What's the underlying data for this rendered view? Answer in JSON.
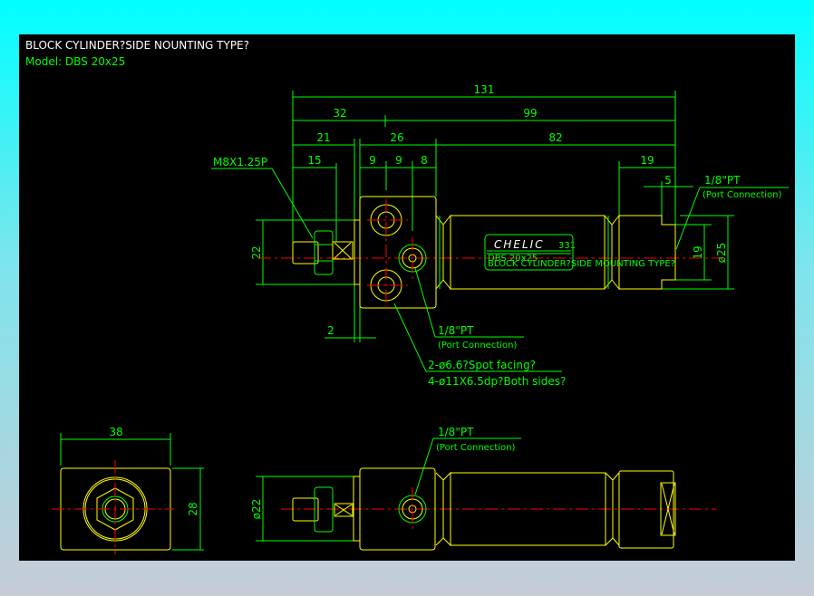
{
  "title": "BLOCK CYLINDER?SIDE NOUNTING TYPE?",
  "model": "Model:  DBS 20x25",
  "colors": {
    "background": "#000000",
    "object": "#ffff00",
    "dimension": "#00ff00",
    "centerline": "#ff0000",
    "title": "#ffffff"
  },
  "front_view": {
    "dims": {
      "d131": "131",
      "d32": "32",
      "d99": "99",
      "d21": "21",
      "d26": "26",
      "d82": "82",
      "d9a": "9",
      "d9b": "9",
      "d8": "8",
      "d15": "15",
      "d19": "19",
      "d5": "5",
      "d22": "22",
      "d19v": "19",
      "d25": "ø25",
      "d2": "2"
    },
    "thread_label": "M8X1.25P",
    "port_label": "1/8\"PT",
    "port_sub": "(Port Connection)",
    "port_label_right": "1/8\"PT",
    "port_sub_right": "(Port Connection)",
    "hole_note_1": "2-ø6.6?Spot facing?",
    "hole_note_2": "4-ø11X6.5dp?Both sides?",
    "nameplate": {
      "brand": "CHELIC",
      "code": "331",
      "line1": "DBS 20x25",
      "line2": "BLOCK CYLINDER?SIDE MOUNTING TYPE?"
    }
  },
  "end_view": {
    "width": "38",
    "height": "28"
  },
  "side_view": {
    "dia": "ø22",
    "port_label": "1/8\"PT",
    "port_sub": "(Port Connection)"
  }
}
